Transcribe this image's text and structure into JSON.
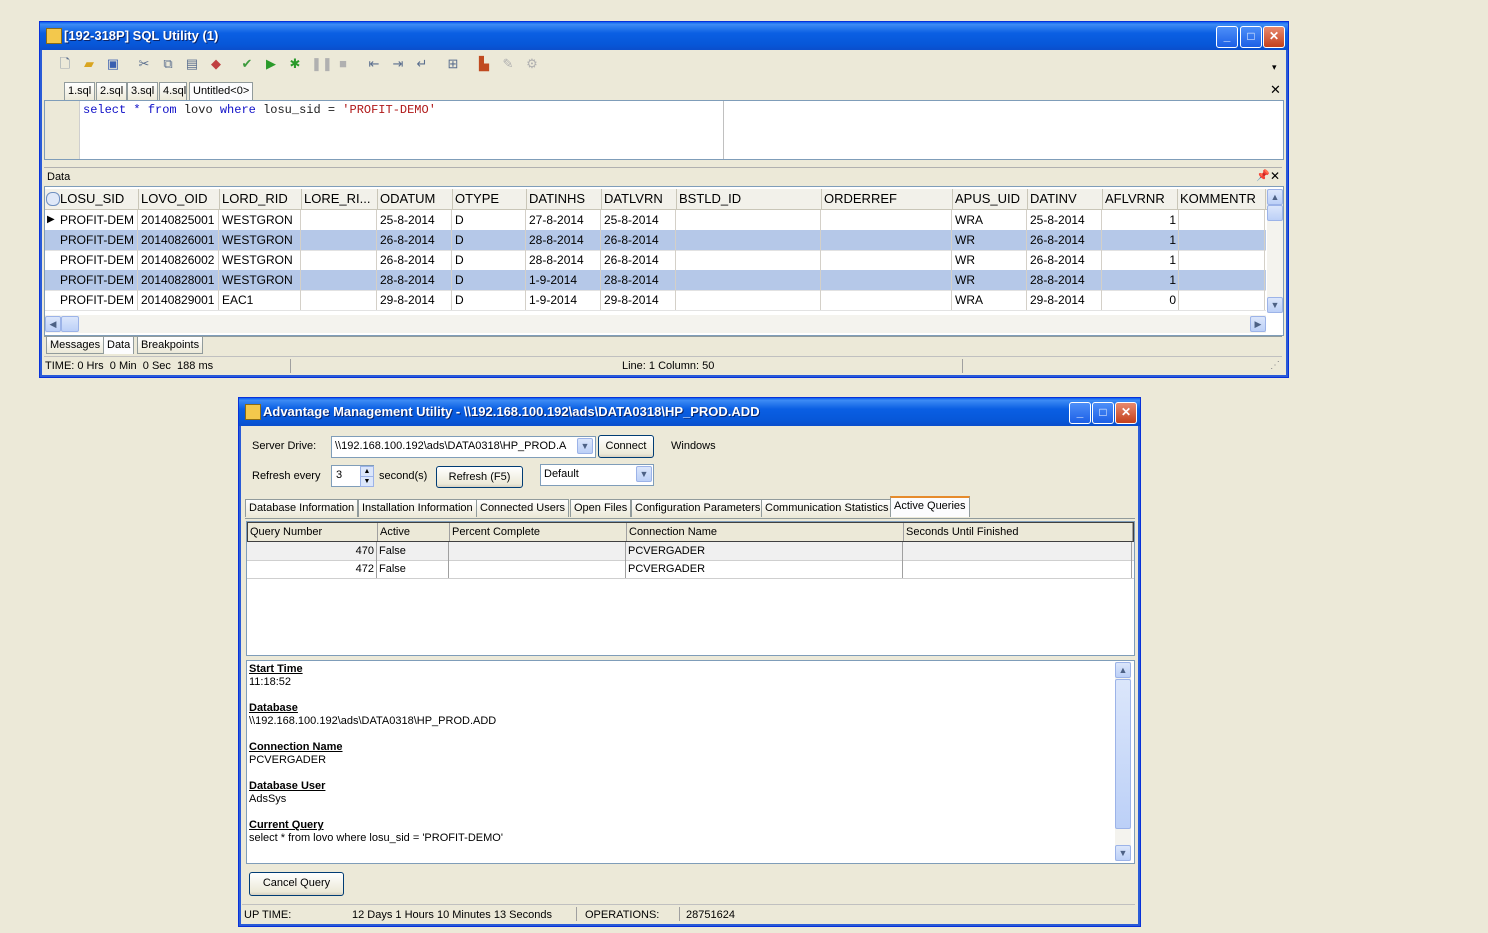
{
  "sql_window": {
    "title": "[192-318P] SQL Utility (1)",
    "tabs": [
      "1.sql",
      "2.sql",
      "3.sql",
      "4.sql",
      "Untitled<0>"
    ],
    "query": {
      "kw1": "select",
      "rest1": " * ",
      "kw2": "from",
      "rest2": " lovo ",
      "kw3": "where",
      "rest3": " losu_sid = ",
      "str": "'PROFIT-DEMO'"
    },
    "data_panel_label": "Data",
    "columns": [
      "LOSU_SID",
      "LOVO_OID",
      "LORD_RID",
      "LORE_RI...",
      "ODATUM",
      "OTYPE",
      "DATINHS",
      "DATLVRN",
      "BSTLD_ID",
      "ORDERREF",
      "APUS_UID",
      "DATINV",
      "AFLVRNR",
      "KOMMENTR"
    ],
    "rows": [
      [
        "PROFIT-DEM",
        "20140825001",
        "WESTGRON",
        "",
        "25-8-2014",
        "D",
        "27-8-2014",
        "25-8-2014",
        "",
        "",
        "WRA",
        "25-8-2014",
        "1",
        ""
      ],
      [
        "PROFIT-DEM",
        "20140826001",
        "WESTGRON",
        "",
        "26-8-2014",
        "D",
        "28-8-2014",
        "26-8-2014",
        "",
        "",
        "WR",
        "26-8-2014",
        "1",
        ""
      ],
      [
        "PROFIT-DEM",
        "20140826002",
        "WESTGRON",
        "",
        "26-8-2014",
        "D",
        "28-8-2014",
        "26-8-2014",
        "",
        "",
        "WR",
        "26-8-2014",
        "1",
        ""
      ],
      [
        "PROFIT-DEM",
        "20140828001",
        "WESTGRON",
        "",
        "28-8-2014",
        "D",
        "1-9-2014",
        "28-8-2014",
        "",
        "",
        "WR",
        "28-8-2014",
        "1",
        ""
      ],
      [
        "PROFIT-DEM",
        "20140829001",
        "EAC1",
        "",
        "29-8-2014",
        "D",
        "1-9-2014",
        "29-8-2014",
        "",
        "",
        "WRA",
        "29-8-2014",
        "0",
        ""
      ]
    ],
    "bottom_tabs": [
      "Messages",
      "Data",
      "Breakpoints"
    ],
    "status_time": "TIME: 0 Hrs  0 Min  0 Sec  188 ms",
    "status_pos": "Line: 1 Column: 50"
  },
  "amu_window": {
    "title": "Advantage Management Utility - \\\\192.168.100.192\\ads\\DATA0318\\HP_PROD.ADD",
    "server_drive_label": "Server Drive:",
    "server_drive_value": "\\\\192.168.100.192\\ads\\DATA0318\\HP_PROD.A",
    "connect_label": "Connect",
    "server_type": "Windows",
    "refresh_every_label": "Refresh every",
    "refresh_value": "3",
    "seconds_label": "second(s)",
    "refresh_button": "Refresh (F5)",
    "default_select": "Default",
    "tabs": [
      "Database Information",
      "Installation Information",
      "Connected Users",
      "Open Files",
      "Configuration Parameters",
      "Communication Statistics",
      "Active Queries"
    ],
    "query_columns": [
      "Query Number",
      "Active",
      "Percent Complete",
      "Connection Name",
      "Seconds Until Finished"
    ],
    "query_rows": [
      [
        "470",
        "False",
        "",
        "PCVERGADER",
        ""
      ],
      [
        "472",
        "False",
        "",
        "PCVERGADER",
        ""
      ]
    ],
    "details": {
      "start_time_label": "Start Time",
      "start_time": "11:18:52",
      "database_label": "Database",
      "database": "\\\\192.168.100.192\\ads\\DATA0318\\HP_PROD.ADD",
      "connection_label": "Connection Name",
      "connection": "PCVERGADER",
      "user_label": "Database User",
      "user": "AdsSys",
      "query_label": "Current Query",
      "query": "select * from lovo where losu_sid = 'PROFIT-DEMO'"
    },
    "cancel_button": "Cancel Query",
    "status": {
      "uptime_label": "UP TIME:",
      "uptime": "12 Days 1 Hours 10 Minutes 13 Seconds",
      "operations_label": "OPERATIONS:",
      "operations": "28751624"
    }
  }
}
